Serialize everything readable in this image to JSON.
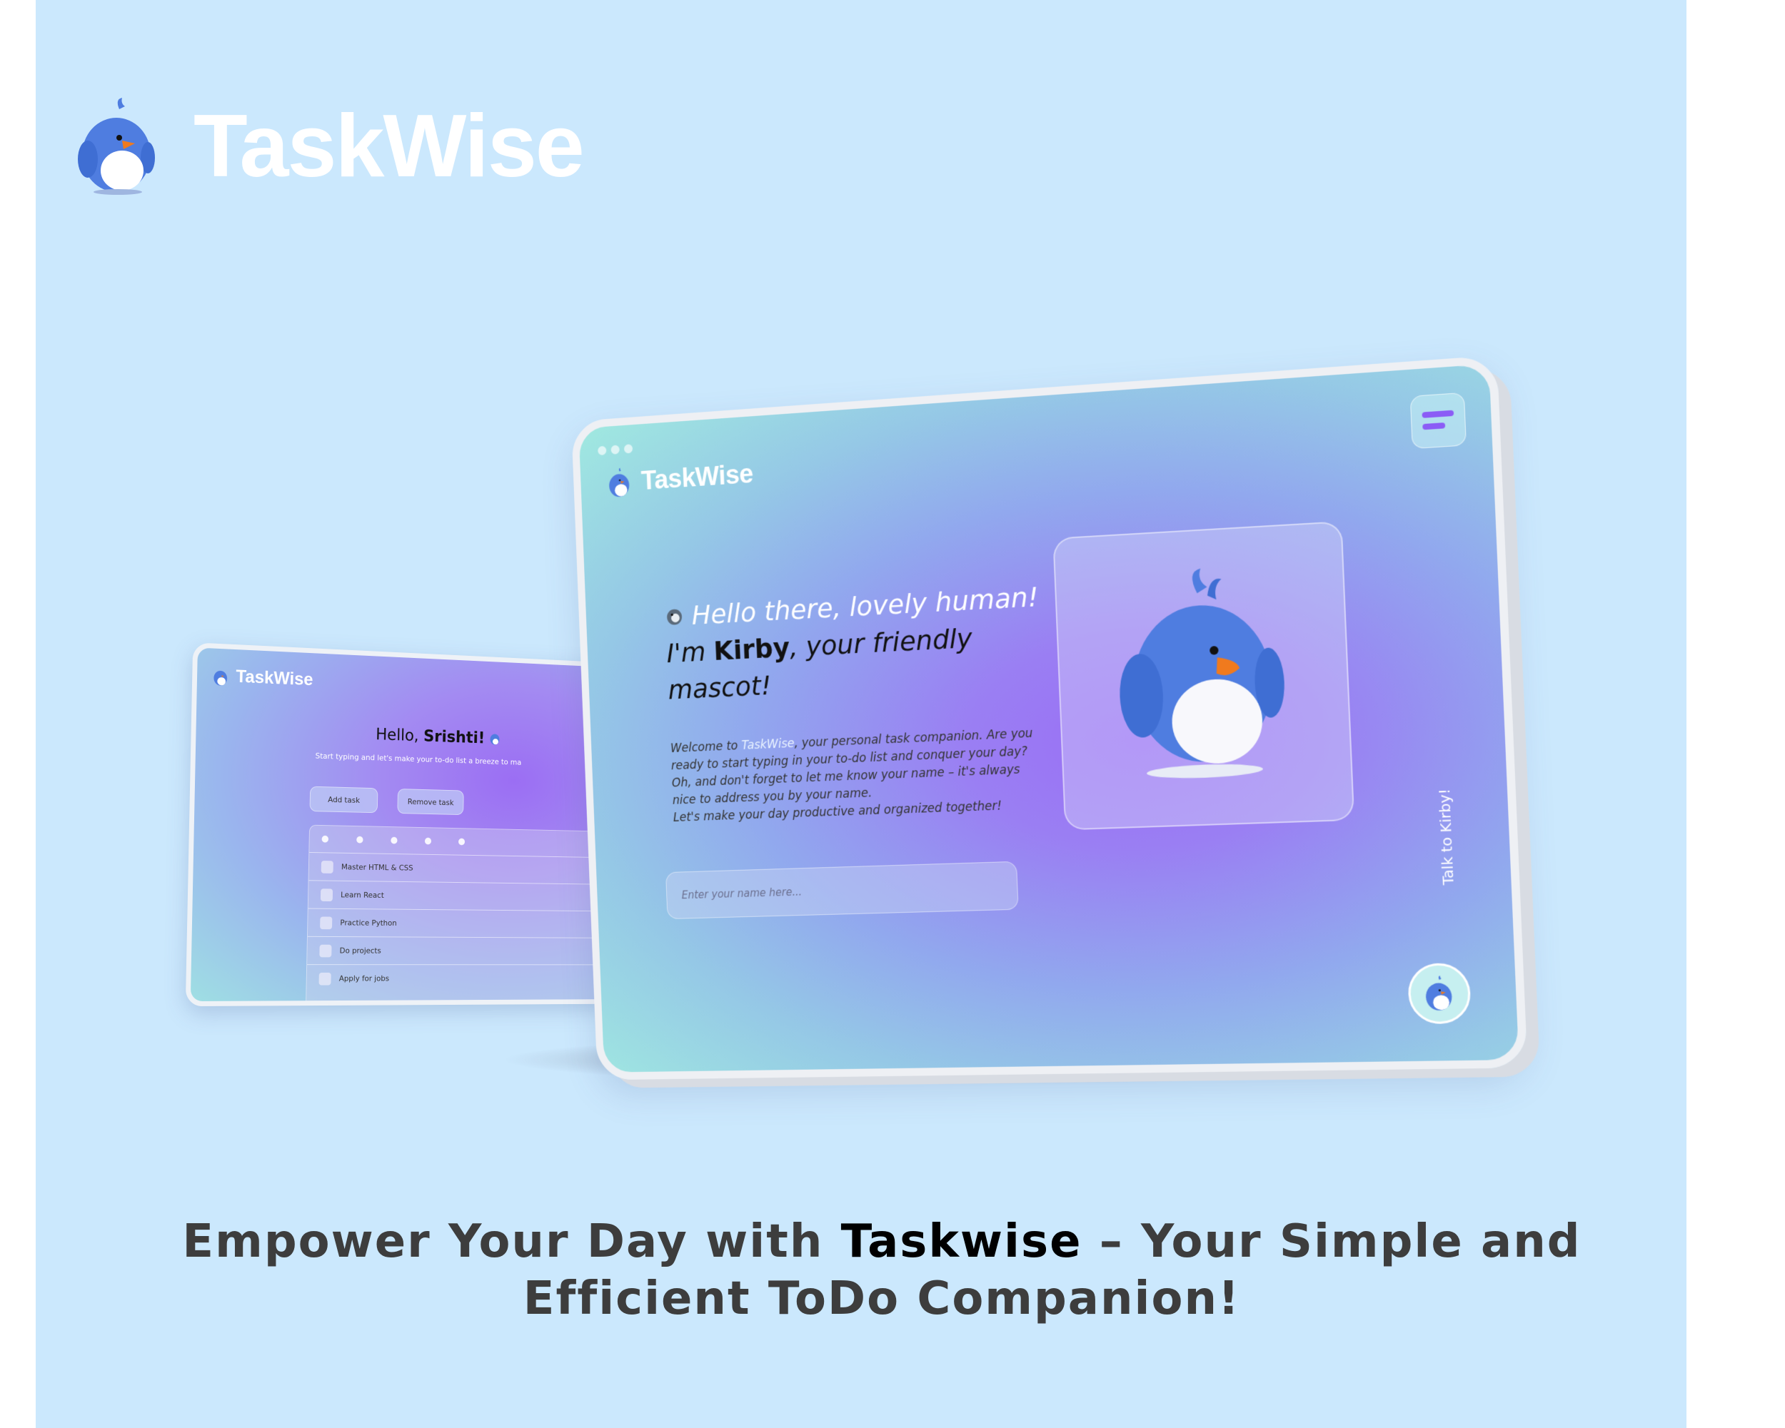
{
  "brand": {
    "title": "TaskWise"
  },
  "back_device": {
    "logo_text": "TaskWise",
    "greeting_prefix": "Hello, ",
    "greeting_name": "Srishti!",
    "subtitle": "Start typing and let's make your to-do list a breeze to ma",
    "add_task_label": "Add task",
    "remove_task_label": "Remove task",
    "tasks": [
      "Master HTML & CSS",
      "Learn React",
      "Practice Python",
      "Do projects",
      "Apply for jobs"
    ]
  },
  "front_device": {
    "logo_text": "TaskWise",
    "heading_line1": "Hello there, lovely human!",
    "heading_prefix": "I'm ",
    "heading_name": "Kirby",
    "heading_suffix": ", your friendly mascot!",
    "body_prefix": "Welcome to ",
    "body_brand": "TaskWise",
    "body_rest": ", your personal task companion. Are you ready to start typing in your to-do list and conquer your day? Oh, and don't forget to let me know your name – it's always nice to address you by your name.",
    "body_last": "Let's make your day productive and organized together!",
    "name_placeholder": "Enter your name here...",
    "talk_label": "Talk to Kirby!"
  },
  "tagline": {
    "prefix": "Empower Your Day with ",
    "brand": "Taskwise",
    "suffix": " – Your Simple and Efficient ToDo Companion!"
  },
  "colors": {
    "background": "#cbe8fd",
    "accent_purple": "#8b5cf6",
    "mascot_blue": "#4f7de0",
    "beak_orange": "#f07a1e"
  }
}
